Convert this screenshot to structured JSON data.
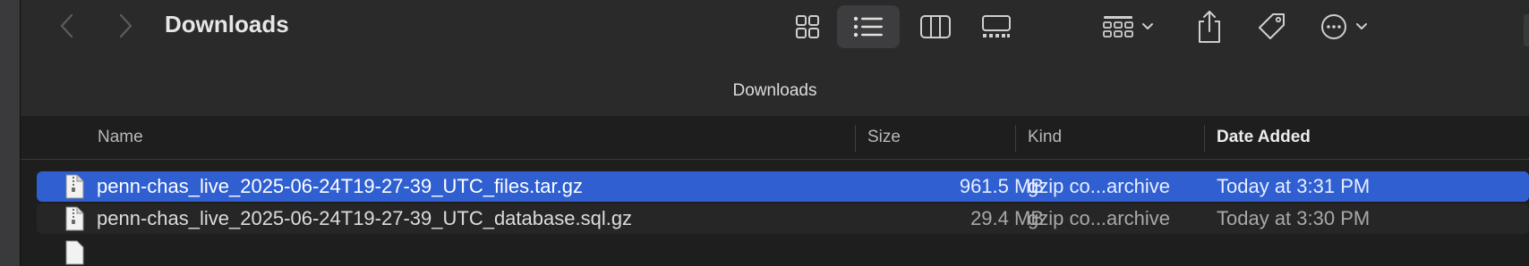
{
  "window": {
    "title": "Downloads",
    "path_label": "Downloads"
  },
  "toolbar": {
    "back_icon": "chevron-left-icon",
    "forward_icon": "chevron-right-icon",
    "view_modes": [
      "icon-view",
      "list-view",
      "column-view",
      "gallery-view"
    ],
    "active_view": "list-view",
    "group_icon": "group-by-icon",
    "share_icon": "share-icon",
    "tag_icon": "tag-icon",
    "more_icon": "ellipsis-icon"
  },
  "columns": {
    "name": "Name",
    "size": "Size",
    "kind": "Kind",
    "date": "Date Added",
    "sorted_by": "Date Added"
  },
  "files": [
    {
      "name": "penn-chas_live_2025-06-24T19-27-39_UTC_files.tar.gz",
      "size": "961.5 MB",
      "kind": "gzip co...archive",
      "date": "Today at 3:31 PM",
      "selected": true
    },
    {
      "name": "penn-chas_live_2025-06-24T19-27-39_UTC_database.sql.gz",
      "size": "29.4 MB",
      "kind": "gzip co...archive",
      "date": "Today at 3:30 PM",
      "selected": false
    }
  ],
  "colors": {
    "selection": "#2f5fd0",
    "background": "#1e1e1e",
    "toolbar": "#2a2a2a"
  }
}
